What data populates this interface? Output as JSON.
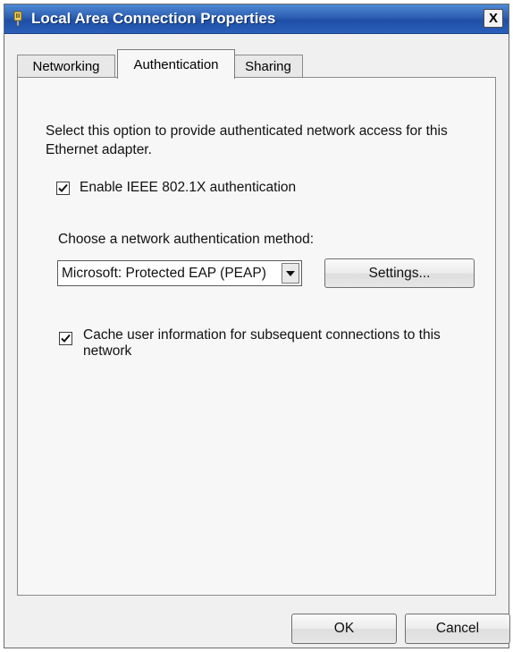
{
  "window": {
    "title": "Local Area Connection Properties",
    "close_label": "X",
    "icon": "network-adapter-icon"
  },
  "tabs": [
    {
      "label": "Networking",
      "active": false
    },
    {
      "label": "Authentication",
      "active": true
    },
    {
      "label": "Sharing",
      "active": false
    }
  ],
  "authentication": {
    "description": "Select this option to provide authenticated network access for this Ethernet adapter.",
    "enable_8021x": {
      "label": "Enable IEEE 802.1X authentication",
      "checked": true
    },
    "method_label": "Choose a network authentication method:",
    "method_value": "Microsoft: Protected EAP (PEAP)",
    "settings_button": "Settings...",
    "cache_user_info": {
      "label": "Cache user information for subsequent connections to this network",
      "checked": true
    }
  },
  "footer": {
    "ok_label": "OK",
    "cancel_label": "Cancel"
  },
  "colors": {
    "titlebar": "#2d5fb3",
    "dialog_bg": "#f0f0f0"
  }
}
